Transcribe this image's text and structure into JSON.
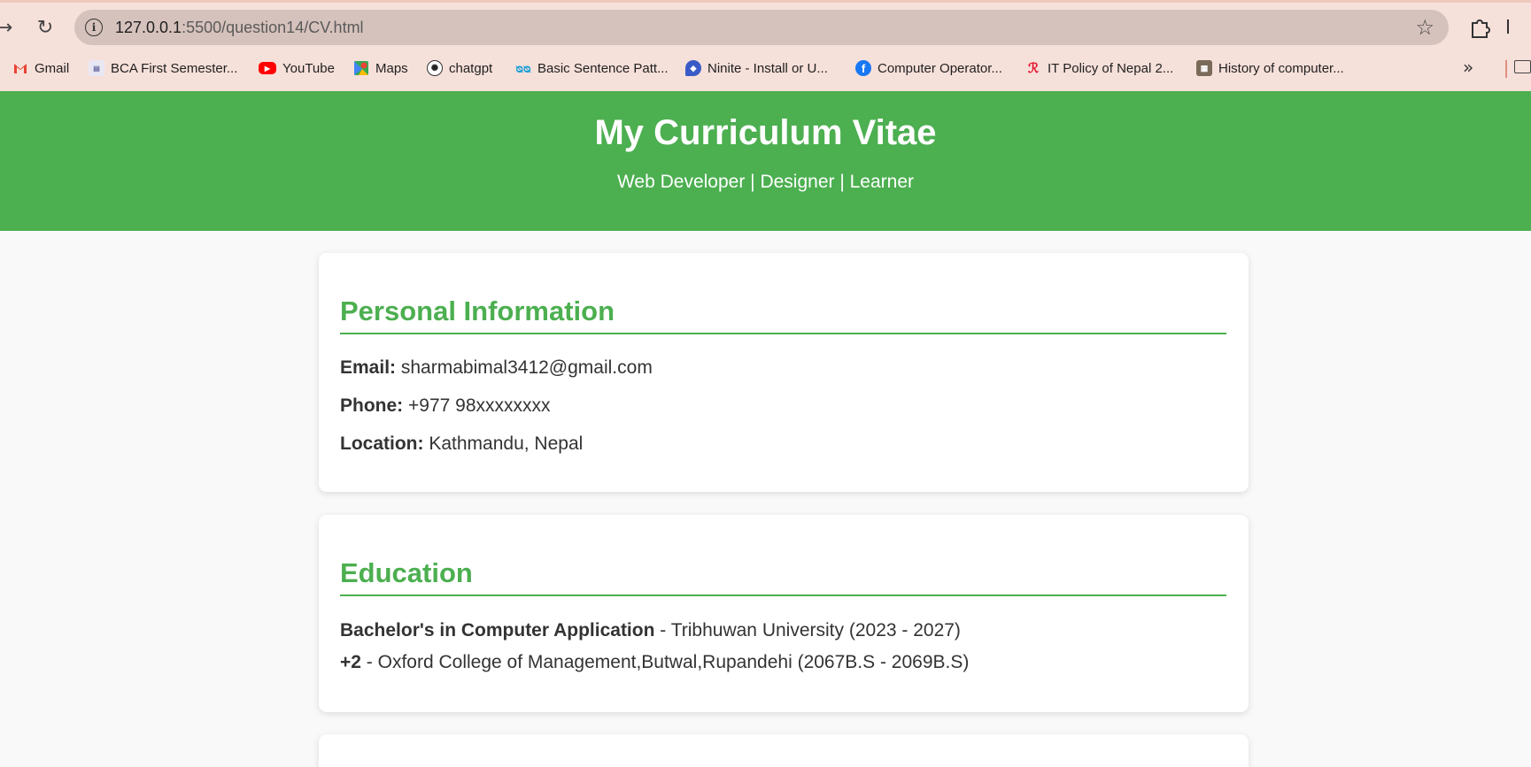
{
  "browser": {
    "url_host": "127.0.0.1",
    "url_rest": ":5500/question14/CV.html",
    "bookmarks": [
      {
        "label": "Gmail",
        "icon": "gmail-icon"
      },
      {
        "label": "BCA First Semester...",
        "icon": "document-icon"
      },
      {
        "label": "YouTube",
        "icon": "youtube-icon"
      },
      {
        "label": "Maps",
        "icon": "maps-icon"
      },
      {
        "label": "chatgpt",
        "icon": "chatgpt-icon"
      },
      {
        "label": "Basic Sentence Patt...",
        "icon": "quillbot-icon"
      },
      {
        "label": "Ninite - Install or U...",
        "icon": "ninite-icon"
      },
      {
        "label": "Computer Operator...",
        "icon": "facebook-icon"
      },
      {
        "label": "IT Policy of Nepal 2...",
        "icon": "site-icon"
      },
      {
        "label": "History of computer...",
        "icon": "image-icon"
      }
    ]
  },
  "header": {
    "title": "My Curriculum Vitae",
    "subtitle": "Web Developer | Designer | Learner"
  },
  "personal": {
    "heading": "Personal Information",
    "email_label": "Email:",
    "email": "sharmabimal3412@gmail.com",
    "phone_label": "Phone:",
    "phone": "+977 98xxxxxxxx",
    "location_label": "Location:",
    "location": "Kathmandu, Nepal"
  },
  "education": {
    "heading": "Education",
    "items": [
      {
        "degree": "Bachelor's in Computer Application",
        "detail": "Tribhuwan University (2023 - 2027)"
      },
      {
        "degree": "+2",
        "detail": "Oxford College of Management,Butwal,Rupandehi (2067B.S - 2069B.S)"
      }
    ]
  },
  "colors": {
    "accent": "#4caf50",
    "chrome_bg": "#f6e0da",
    "omnibox_bg": "#d6c2bc"
  }
}
